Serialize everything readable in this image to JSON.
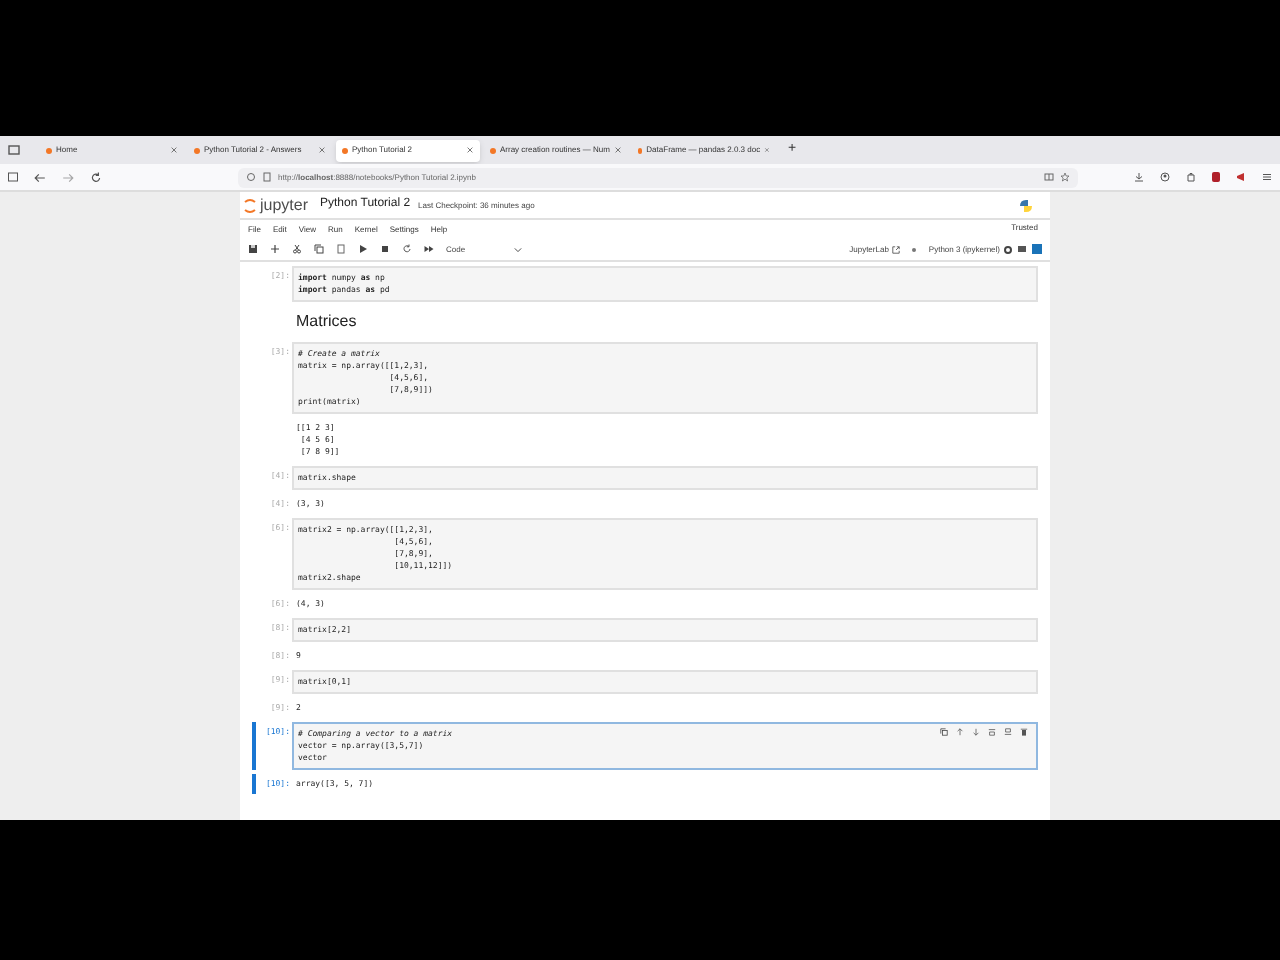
{
  "browser": {
    "tabs": [
      {
        "title": "Home",
        "selected": false
      },
      {
        "title": "Python Tutorial 2 - Answers",
        "selected": false
      },
      {
        "title": "Python Tutorial 2",
        "selected": true
      },
      {
        "title": "Array creation routines — Num",
        "selected": false
      },
      {
        "title": "DataFrame — pandas 2.0.3 doc",
        "selected": false
      }
    ],
    "new_tab": "+",
    "url": "http://**localhost**:8888/notebooks/Python Tutorial 2.ipynb"
  },
  "notebook": {
    "logo": "jupyter",
    "title": "Python Tutorial 2",
    "checkpoint": "Last Checkpoint: 36 minutes ago",
    "trusted": "Trusted",
    "menu": [
      "File",
      "Edit",
      "View",
      "Run",
      "Kernel",
      "Settings",
      "Help"
    ],
    "cell_type": "Code",
    "jupyterlab": "JupyterLab",
    "kernel": "Python 3 (ipykernel)"
  },
  "cells": [
    {
      "kind": "code",
      "selected": false,
      "prompt": "[2]:",
      "lines": [
        "**import** numpy **as** np",
        "**import** pandas **as** pd"
      ]
    },
    {
      "kind": "markdown",
      "text": "Matrices"
    },
    {
      "kind": "code",
      "selected": false,
      "prompt": "[3]:",
      "lines": [
        "*# Create a matrix*",
        "matrix = np.array([[1,2,3],",
        "                   [4,5,6],",
        "                   [7,8,9]])",
        "print(matrix)"
      ],
      "output": {
        "lines": [
          "[[1 2 3]",
          " [4 5 6]",
          " [7 8 9]]"
        ]
      }
    },
    {
      "kind": "code",
      "selected": false,
      "prompt": "[4]:",
      "lines": [
        "matrix.shape"
      ],
      "output": {
        "prompt": "[4]:",
        "lines": [
          "(3, 3)"
        ]
      }
    },
    {
      "kind": "code",
      "selected": false,
      "prompt": "[6]:",
      "lines": [
        "matrix2 = np.array([[1,2,3],",
        "                    [4,5,6],",
        "                    [7,8,9],",
        "                    [10,11,12]])",
        "matrix2.shape"
      ],
      "output": {
        "prompt": "[6]:",
        "lines": [
          "(4, 3)"
        ]
      }
    },
    {
      "kind": "code",
      "selected": false,
      "prompt": "[8]:",
      "lines": [
        "matrix[2,2]"
      ],
      "output": {
        "prompt": "[8]:",
        "lines": [
          "9"
        ]
      }
    },
    {
      "kind": "code",
      "selected": false,
      "prompt": "[9]:",
      "lines": [
        "matrix[0,1]"
      ],
      "output": {
        "prompt": "[9]:",
        "lines": [
          "2"
        ]
      }
    },
    {
      "kind": "code",
      "selected": true,
      "prompt": "[10]:",
      "lines": [
        "*# Comparing a vector to a matrix*",
        "vector = np.array([3,5,7])",
        "vector"
      ],
      "output": {
        "prompt": "[10]:",
        "lines": [
          "array([3, 5, 7])"
        ]
      }
    }
  ]
}
